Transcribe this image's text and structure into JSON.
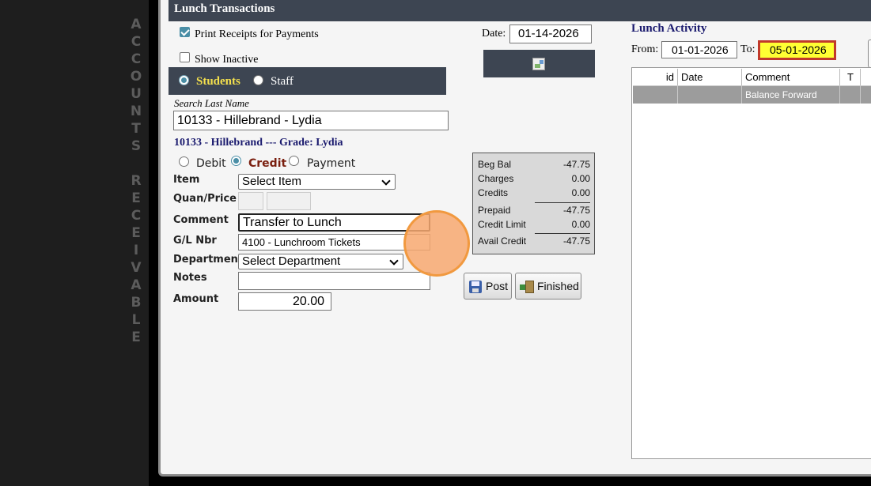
{
  "sidebar_vertical_text": [
    "A",
    "C",
    "C",
    "O",
    "U",
    "N",
    "T",
    "S",
    "",
    "R",
    "E",
    "C",
    "E",
    "I",
    "V",
    "A",
    "B",
    "L",
    "E"
  ],
  "window": {
    "title": "Lunch Transactions"
  },
  "options": {
    "print_receipts_label": "Print Receipts for Payments",
    "print_receipts_checked": true,
    "show_inactive_label": "Show Inactive",
    "show_inactive_checked": false
  },
  "date": {
    "label": "Date:",
    "value": "01-14-2026"
  },
  "person_type": {
    "students_label": "Students",
    "staff_label": "Staff",
    "selected": "Students"
  },
  "search": {
    "label": "Search Last Name",
    "value": "10133 - Hillebrand - Lydia"
  },
  "selected_student": {
    "heading": "10133 - Hillebrand --- Grade: Lydia"
  },
  "transaction_type": {
    "debit_label": "Debit",
    "credit_label": "Credit",
    "payment_label": "Payment",
    "selected": "Credit"
  },
  "form": {
    "item_label": "Item",
    "item_value": "Select Item",
    "quan_price_label": "Quan/Price",
    "quantity_value": "",
    "price_value": "",
    "comment_label": "Comment",
    "comment_value": "Transfer to Lunch",
    "gl_label": "G/L Nbr",
    "gl_value": "4100 - Lunchroom Tickets",
    "department_label": "Department",
    "department_value": "Select Department",
    "notes_label": "Notes",
    "notes_value": "",
    "amount_label": "Amount",
    "amount_value": "20.00"
  },
  "balance": {
    "beg_bal_label": "Beg Bal",
    "beg_bal": "-47.75",
    "charges_label": "Charges",
    "charges": "0.00",
    "credits_label": "Credits",
    "credits": "0.00",
    "prepaid_label": "Prepaid",
    "prepaid": "-47.75",
    "credit_limit_label": "Credit Limit",
    "credit_limit": "0.00",
    "avail_credit_label": "Avail Credit",
    "avail_credit": "-47.75"
  },
  "buttons": {
    "post_label": "Post",
    "finished_label": "Finished"
  },
  "activity": {
    "title": "Lunch Activity",
    "from_label": "From:",
    "from_value": "01-01-2026",
    "to_label": "To:",
    "to_value": "05-01-2026",
    "columns": [
      "id",
      "Date",
      "Comment",
      "T"
    ],
    "rows": [
      {
        "id": "",
        "date": "",
        "comment": "Balance Forward",
        "t": ""
      }
    ]
  },
  "colors": {
    "titlebar": "#3d4552",
    "students_label": "#f4e04d",
    "credit_label": "#7a1f0f",
    "heading_navy": "#1a1a6e",
    "to_date_highlight": "#ffff33",
    "to_date_border": "#c0392b",
    "cursor_highlight": "#f7a870"
  }
}
